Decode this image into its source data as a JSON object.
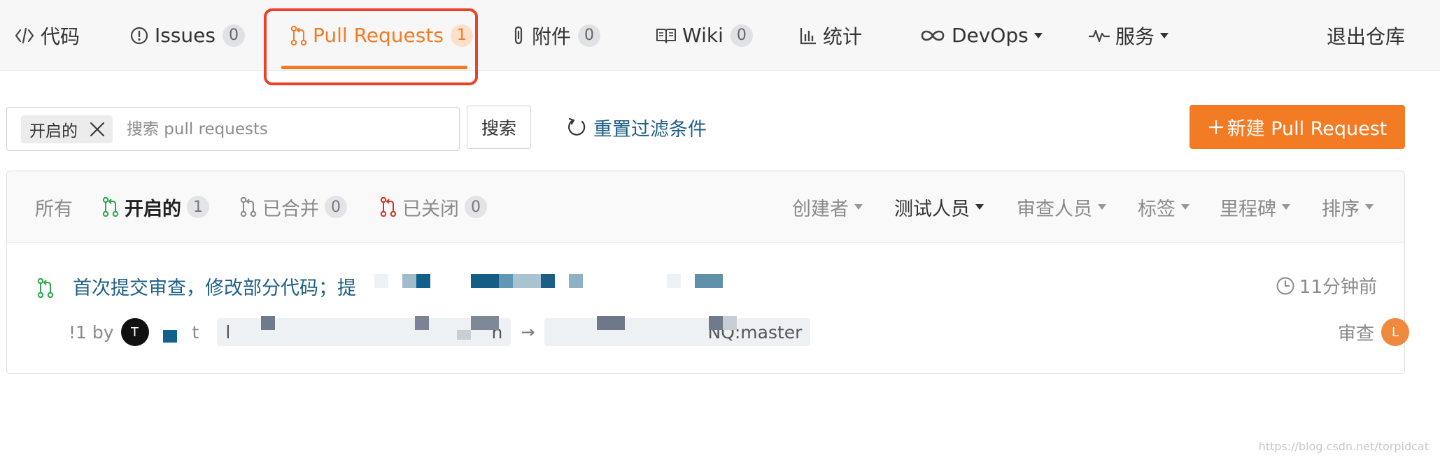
{
  "nav": {
    "tabs": [
      {
        "label": "代码",
        "icon": "code-icon"
      },
      {
        "label": "Issues",
        "icon": "issue-icon",
        "badge": "0"
      },
      {
        "label": "Pull Requests",
        "icon": "pull-request-icon",
        "badge": "1",
        "active": true
      },
      {
        "label": "附件",
        "icon": "paperclip-icon",
        "badge": "0"
      },
      {
        "label": "Wiki",
        "icon": "book-icon",
        "badge": "0"
      },
      {
        "label": "统计",
        "icon": "bar-chart-icon"
      },
      {
        "label": "DevOps",
        "icon": "infinity-icon",
        "dropdown": true
      },
      {
        "label": "服务",
        "icon": "pulse-icon",
        "dropdown": true
      }
    ],
    "exit_label": "退出仓库",
    "accent_color": "#f37b24",
    "highlight_color": "#e8422a"
  },
  "filter_bar": {
    "active_chip": "开启的",
    "search_placeholder": "搜索 pull requests",
    "search_button": "搜索",
    "reset_label": "重置过滤条件",
    "new_pr_label": "新建 Pull Request"
  },
  "list": {
    "state_tabs": [
      {
        "label": "所有"
      },
      {
        "label": "开启的",
        "badge": "1",
        "active": true,
        "icon": "pr-open-icon"
      },
      {
        "label": "已合并",
        "badge": "0",
        "icon": "pr-merged-icon"
      },
      {
        "label": "已关闭",
        "badge": "0",
        "icon": "pr-closed-icon"
      }
    ],
    "filters": [
      "创建者",
      "测试人员",
      "审查人员",
      "标签",
      "里程碑",
      "排序"
    ],
    "items": [
      {
        "title": "首次提交审查，修改部分代码；提",
        "time": "11分钟前",
        "number_prefix": "!1 by",
        "author_avatar": "T",
        "author_suffix": "t",
        "source_branch": "l",
        "source_branch_tail": "n",
        "target_branch": "NQ:master",
        "review_label": "审查",
        "reviewer_avatar": "L"
      }
    ]
  },
  "watermark": "https://blog.csdn.net/torpidcat"
}
